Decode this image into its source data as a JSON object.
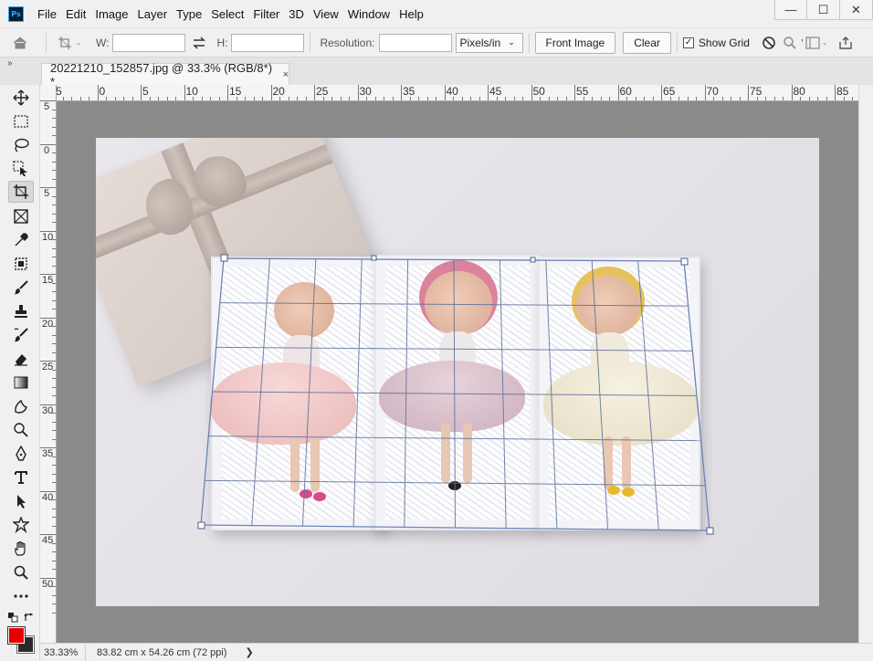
{
  "app": {
    "logo": "Ps",
    "menu": [
      "File",
      "Edit",
      "Image",
      "Layer",
      "Type",
      "Select",
      "Filter",
      "3D",
      "View",
      "Window",
      "Help"
    ],
    "window_controls": {
      "minimize": "—",
      "maximize": "☐",
      "close": "✕"
    }
  },
  "options": {
    "width_label": "W:",
    "height_label": "H:",
    "width_value": "",
    "height_value": "",
    "resolution_label": "Resolution:",
    "resolution_value": "",
    "unit_selected": "Pixels/in",
    "front_image_label": "Front Image",
    "clear_label": "Clear",
    "show_grid_label": "Show Grid",
    "show_grid_checked": true
  },
  "document": {
    "tab_title": "20221210_152857.jpg @ 33.3% (RGB/8*) *",
    "close_glyph": "×"
  },
  "rulers": {
    "horizontal": [
      "5",
      "0",
      "5",
      "10",
      "15",
      "20",
      "25",
      "30",
      "35",
      "40",
      "45",
      "50",
      "55",
      "60",
      "65",
      "70",
      "75",
      "80",
      "85"
    ],
    "vertical": [
      "5",
      "0",
      "5",
      "10",
      "15",
      "20",
      "25",
      "30",
      "35",
      "40",
      "45",
      "50"
    ]
  },
  "tools": [
    "move-tool",
    "marquee-tool",
    "lasso-tool",
    "object-selection-tool",
    "perspective-crop-tool",
    "frame-tool",
    "eyedropper-tool",
    "patch-tool",
    "brush-tool",
    "stamp-tool",
    "history-brush-tool",
    "eraser-tool",
    "gradient-tool",
    "blur-tool",
    "dodge-tool",
    "pen-tool",
    "type-tool",
    "path-selection-tool",
    "custom-shape-tool",
    "hand-tool",
    "zoom-tool",
    "more-tools"
  ],
  "colors": {
    "foreground": "#e60000",
    "background": "#2a2a2a"
  },
  "status": {
    "zoom": "33.33%",
    "dimensions": "83.82 cm x 54.26 cm (72 ppi)",
    "arrow": "❯"
  }
}
